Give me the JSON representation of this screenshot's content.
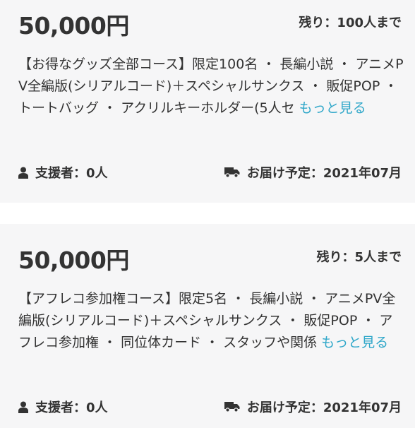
{
  "rewards": [
    {
      "price": "50,000円",
      "remaining": "残り：100人まで",
      "description": "【お得なグッズ全部コース】限定100名 ・ 長編小説 ・ アニメPV全編版(シリアルコード)＋スペシャルサンクス ・ 販促POP ・ トートバッグ ・ アクリルキーホルダー(5人セ",
      "more_label": "もっと見る",
      "supporters": "支援者：0人",
      "delivery": "お届け予定：2021年07月"
    },
    {
      "price": "50,000円",
      "remaining": "残り：5人まで",
      "description": "【アフレコ参加権コース】限定5名 ・ 長編小説 ・ アニメPV全編版(シリアルコード)＋スペシャルサンクス ・ 販促POP ・ アフレコ参加権 ・ 同位体カード ・ スタッフや関係",
      "more_label": "もっと見る",
      "supporters": "支援者：0人",
      "delivery": "お届け予定：2021年07月"
    }
  ],
  "icons": {
    "supporters": "user-icon",
    "delivery": "truck-icon"
  },
  "colors": {
    "link": "#2fa7c9",
    "card_bg": "#f6f6f7",
    "text": "#333333"
  }
}
